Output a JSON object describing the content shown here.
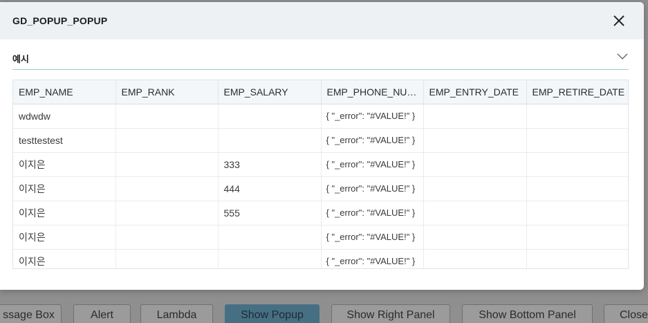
{
  "popup": {
    "title": "GD_POPUP_POPUP",
    "section_title": "예시"
  },
  "grid": {
    "columns": [
      "EMP_NAME",
      "EMP_RANK",
      "EMP_SALARY",
      "EMP_PHONE_NU…",
      "EMP_ENTRY_DATE",
      "EMP_RETIRE_DATE"
    ],
    "rows": [
      [
        "wdwdw",
        "",
        "",
        "{ \"_error\": \"#VALUE!\" }",
        "",
        ""
      ],
      [
        "testtestest",
        "",
        "",
        "{ \"_error\": \"#VALUE!\" }",
        "",
        ""
      ],
      [
        "이지은",
        "",
        "333",
        "{ \"_error\": \"#VALUE!\" }",
        "",
        ""
      ],
      [
        "이지은",
        "",
        "444",
        "{ \"_error\": \"#VALUE!\" }",
        "",
        ""
      ],
      [
        "이지은",
        "",
        "555",
        "{ \"_error\": \"#VALUE!\" }",
        "",
        ""
      ],
      [
        "이지은",
        "",
        "",
        "{ \"_error\": \"#VALUE!\" }",
        "",
        ""
      ],
      [
        "이지은",
        "",
        "",
        "{ \"_error\": \"#VALUE!\" }",
        "",
        ""
      ]
    ]
  },
  "background_buttons": [
    {
      "label": "ssage Box"
    },
    {
      "label": "Alert"
    },
    {
      "label": "Lambda"
    },
    {
      "label": "Show Popup",
      "active": true
    },
    {
      "label": "Show Right Panel"
    },
    {
      "label": "Show Bottom Panel"
    },
    {
      "label": "Close"
    }
  ],
  "colors": {
    "header_bg": "#eef1f4",
    "section_underline": "#9fcfc2",
    "active_button": "#476f83",
    "overlay": "#8f8f8f"
  },
  "icons": {
    "close": "close-icon",
    "collapse": "chevron-down-icon"
  }
}
